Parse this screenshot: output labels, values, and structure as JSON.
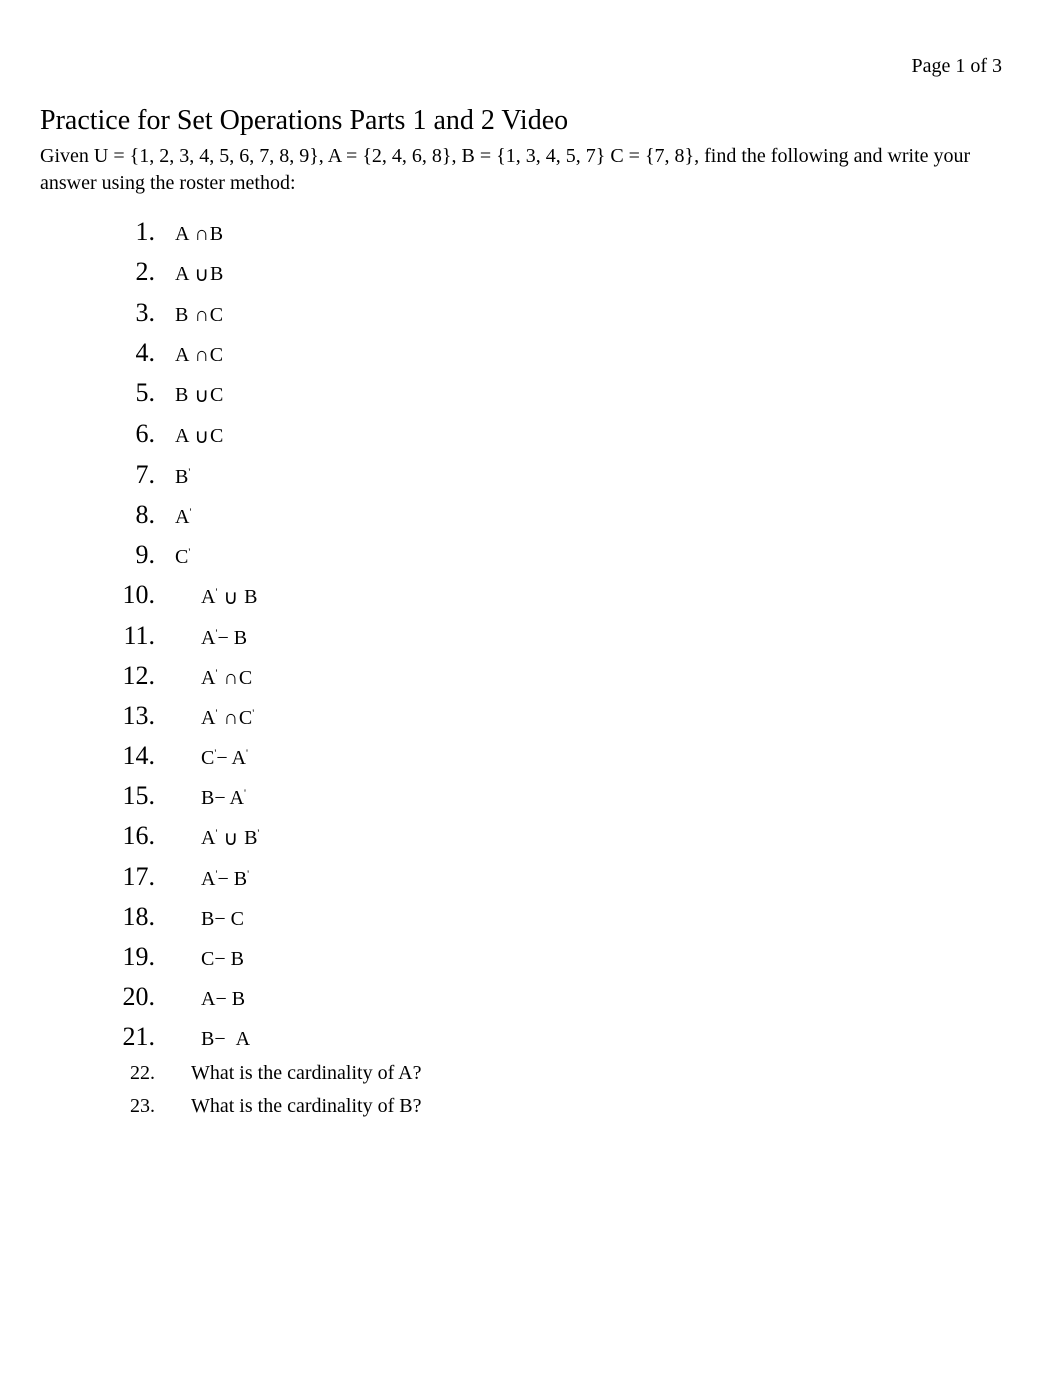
{
  "page_indicator": "Page  1 of 3",
  "title": "Practice for Set Operations Parts 1 and 2 Video",
  "instructions": "Given U = {1, 2, 3, 4, 5, 6, 7, 8, 9}, A = {2, 4, 6, 8}, B = {1, 3, 4, 5, 7} C = {7, 8}, find the following and write your answer using the roster method:",
  "chart_data": {
    "type": "table",
    "sets": {
      "U": [
        1,
        2,
        3,
        4,
        5,
        6,
        7,
        8,
        9
      ],
      "A": [
        2,
        4,
        6,
        8
      ],
      "B": [
        1,
        3,
        4,
        5,
        7
      ],
      "C": [
        7,
        8
      ]
    },
    "problems": [
      {
        "n": 1,
        "expr": "A ∩ B"
      },
      {
        "n": 2,
        "expr": "A ∪ B"
      },
      {
        "n": 3,
        "expr": "B ∩ C"
      },
      {
        "n": 4,
        "expr": "A ∩ C"
      },
      {
        "n": 5,
        "expr": "B ∪ C"
      },
      {
        "n": 6,
        "expr": "A ∪ C"
      },
      {
        "n": 7,
        "expr": "B'"
      },
      {
        "n": 8,
        "expr": "A'"
      },
      {
        "n": 9,
        "expr": "C'"
      },
      {
        "n": 10,
        "expr": "A' ∪ B"
      },
      {
        "n": 11,
        "expr": "A' − B"
      },
      {
        "n": 12,
        "expr": "A' ∩ C"
      },
      {
        "n": 13,
        "expr": "A' ∩ C'"
      },
      {
        "n": 14,
        "expr": "C' − A'"
      },
      {
        "n": 15,
        "expr": "B − A'"
      },
      {
        "n": 16,
        "expr": "A' ∪ B'"
      },
      {
        "n": 17,
        "expr": "A' − B'"
      },
      {
        "n": 18,
        "expr": "B − C"
      },
      {
        "n": 19,
        "expr": "C − B"
      },
      {
        "n": 20,
        "expr": "A − B"
      },
      {
        "n": 21,
        "expr": "B − A"
      },
      {
        "n": 22,
        "text": "What is the cardinality of A?"
      },
      {
        "n": 23,
        "text": "What is the cardinality of B?"
      }
    ]
  },
  "labels": {
    "q22": "What is the cardinality of A?",
    "q23": "What is the cardinality of B?"
  },
  "sym": {
    "A": "A",
    "B": "B",
    "C": "C",
    "cap": "∩",
    "cup": "∪",
    "minus": "−",
    "prime": "'"
  },
  "num": {
    "n1": "1.",
    "n2": "2.",
    "n3": "3.",
    "n4": "4.",
    "n5": "5.",
    "n6": "6.",
    "n7": "7.",
    "n8": "8.",
    "n9": "9.",
    "n10": "10.",
    "n11": "11.",
    "n12": "12.",
    "n13": "13.",
    "n14": "14.",
    "n15": "15.",
    "n16": "16.",
    "n17": "17.",
    "n18": "18.",
    "n19": "19.",
    "n20": "20.",
    "n21": "21.",
    "n22": "22.",
    "n23": "23."
  }
}
